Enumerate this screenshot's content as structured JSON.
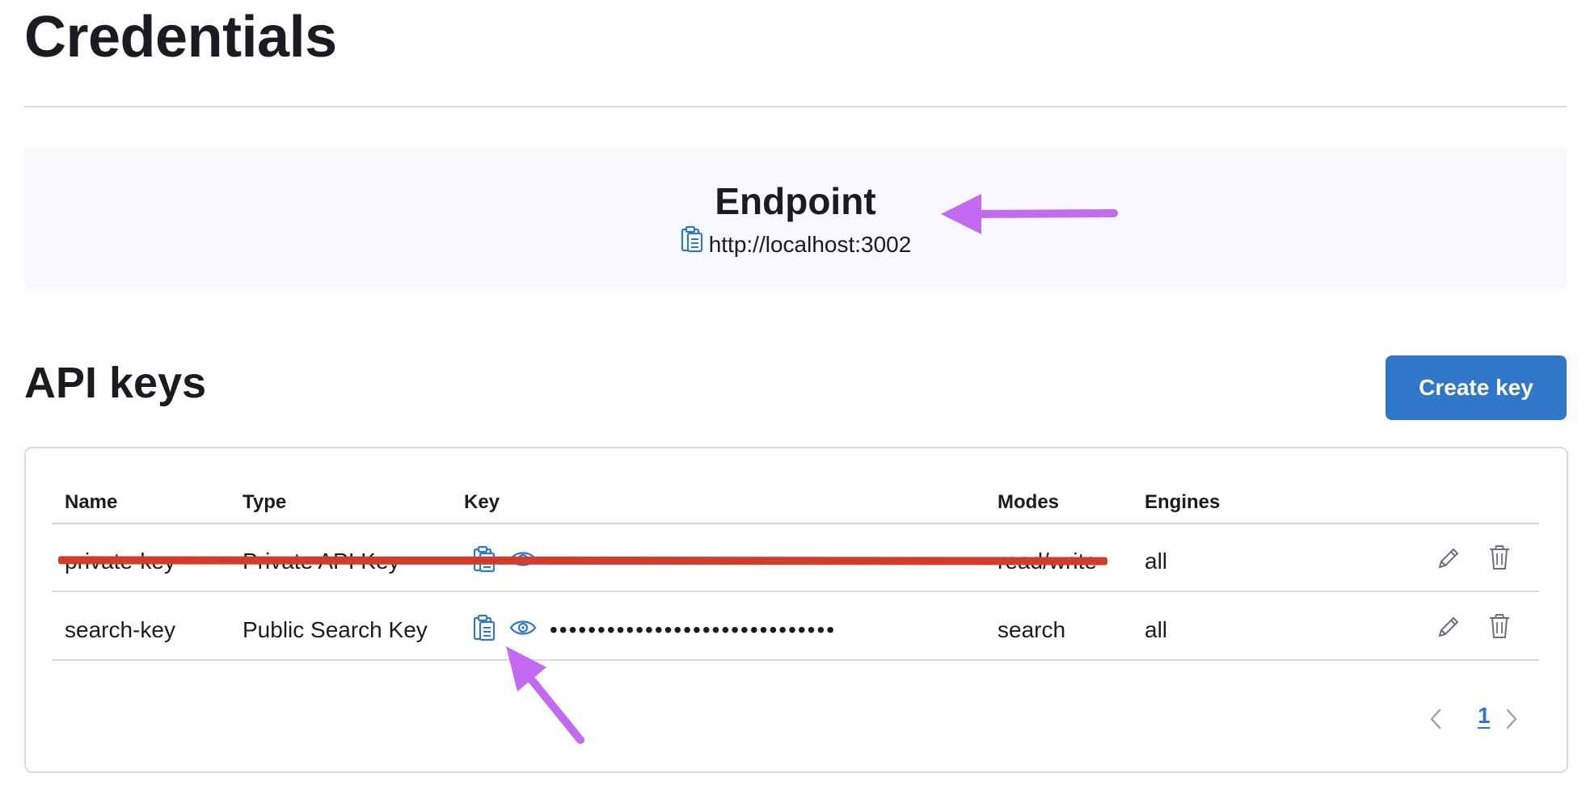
{
  "page": {
    "title": "Credentials"
  },
  "endpoint": {
    "title": "Endpoint",
    "url": "http://localhost:3002"
  },
  "api_keys": {
    "title": "API keys",
    "create_button_label": "Create key",
    "columns": [
      "Name",
      "Type",
      "Key",
      "Modes",
      "Engines"
    ],
    "rows": [
      {
        "name": "private-key",
        "type": "Private API Key",
        "key_masked": "••••••••••••••••••••••••••••••",
        "modes": "read/write",
        "engines": "all",
        "struck_through": true
      },
      {
        "name": "search-key",
        "type": "Public Search Key",
        "key_masked": "••••••••••••••••••••••••••••••",
        "modes": "search",
        "engines": "all",
        "struck_through": false
      }
    ],
    "pagination": {
      "current_page": "1"
    }
  },
  "colors": {
    "accent": "#3077c9",
    "panel_background": "#f7f8fc",
    "border": "#d3dae6",
    "annotation_arrow": "#c36af0",
    "strike": "#d23c2c",
    "icon_gray": "#69707d"
  },
  "icons": {
    "copy": "clipboard-icon",
    "reveal": "eye-icon",
    "edit": "pencil-icon",
    "delete": "trash-icon",
    "prev": "chevron-left-icon",
    "next": "chevron-right-icon"
  }
}
